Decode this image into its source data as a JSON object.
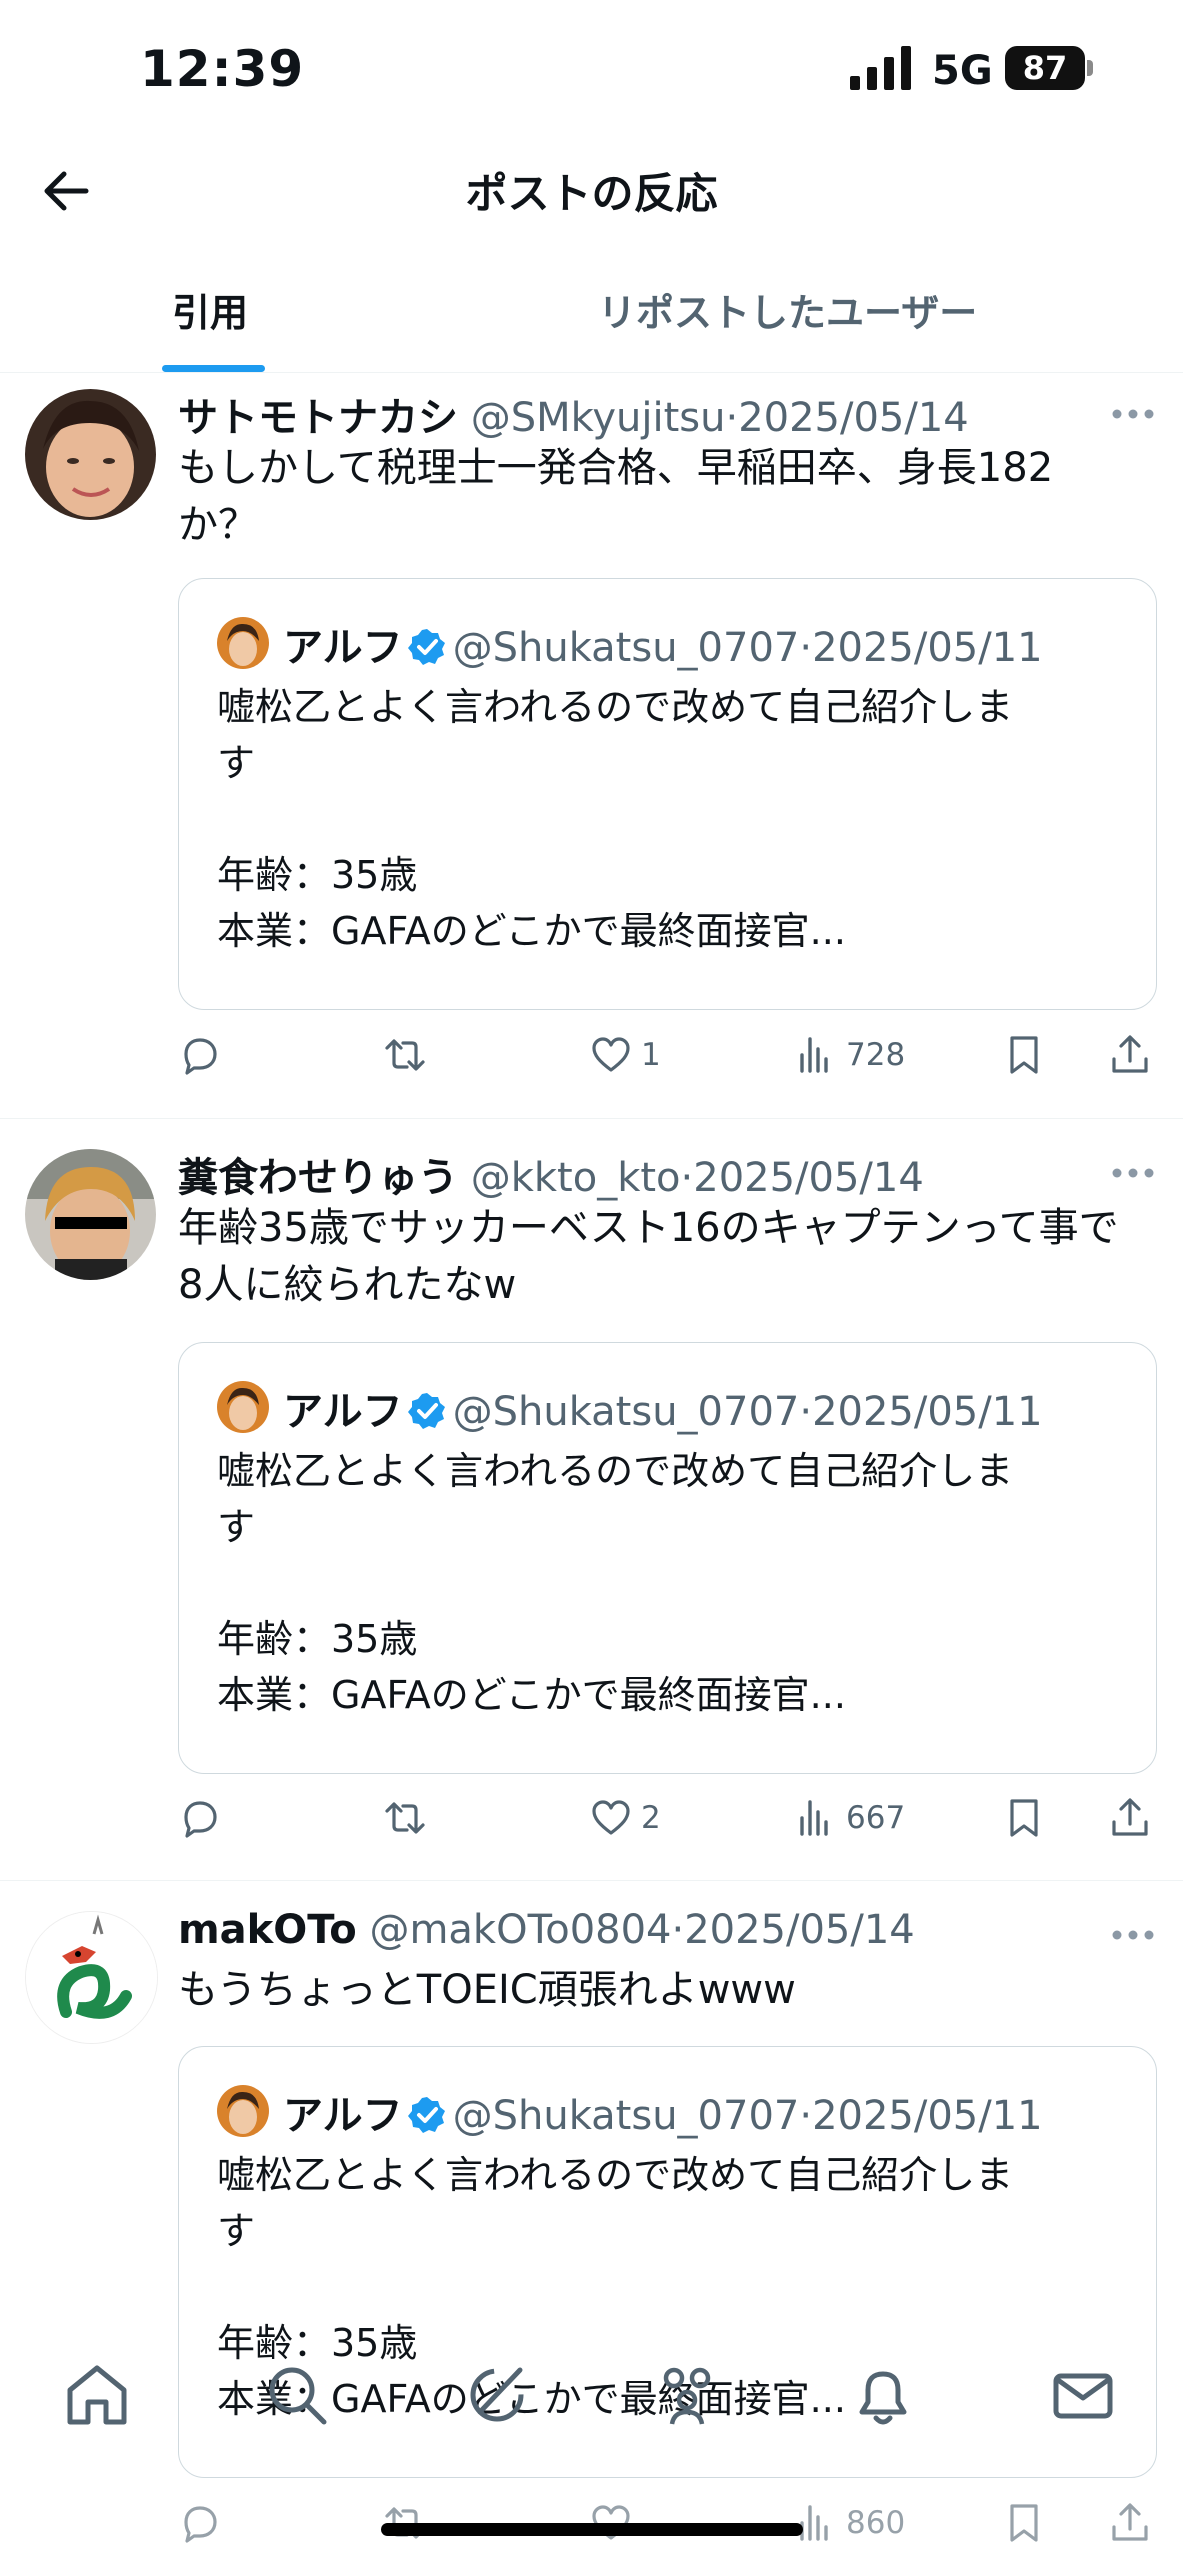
{
  "status_bar": {
    "time": "12:39",
    "network": "5G",
    "battery": "87"
  },
  "header": {
    "title": "ポストの反応"
  },
  "tabs": [
    {
      "label": "引用",
      "active": true
    },
    {
      "label": "リポストしたユーザー",
      "active": false
    }
  ],
  "posts": [
    {
      "name": "サトモトナカシ",
      "handle": "@SMkyujitsu",
      "sep": "·",
      "date": "2025/05/14",
      "text": "もしかして税理士一発合格、早稲田卒、身長182\nか？",
      "quote": {
        "name": "アルフ",
        "handle": "@Shukatsu_0707",
        "sep": "·",
        "date": "2025/05/11",
        "text": "嘘松乙とよく言われるので改めて自己紹介しま\nす\n\n年齢：35歳\n本業：GAFAのどこかで最終面接官..."
      },
      "likes": "1",
      "views": "728"
    },
    {
      "name": "糞食わせりゅう",
      "handle": "@kkto_kto",
      "sep": "·",
      "date": "2025/05/14",
      "text": "年齢35歳でサッカーベスト16のキャプテンって事で\n8人に絞られたなw",
      "quote": {
        "name": "アルフ",
        "handle": "@Shukatsu_0707",
        "sep": "·",
        "date": "2025/05/11",
        "text": "嘘松乙とよく言われるので改めて自己紹介しま\nす\n\n年齢：35歳\n本業：GAFAのどこかで最終面接官..."
      },
      "likes": "2",
      "views": "667"
    },
    {
      "name": "makOTo",
      "handle": "@makOTo0804",
      "sep": "·",
      "date": "2025/05/14",
      "text": "もうちょっとTOEIC頑張れよwww",
      "quote": {
        "name": "アルフ",
        "handle": "@Shukatsu_0707",
        "sep": "·",
        "date": "2025/05/11",
        "text": "嘘松乙とよく言われるので改めて自己紹介しま\nす\n\n年齢：35歳\n本業：GAFAのどこかで最終面接官..."
      },
      "likes": "",
      "views": "860"
    }
  ],
  "icons": {
    "back": "arrow-left-icon",
    "more": "more-dots-icon",
    "reply": "reply-icon",
    "repost": "repost-icon",
    "like": "heart-icon",
    "views": "views-icon",
    "bookmark": "bookmark-icon",
    "share": "share-icon",
    "verified": "verified-badge-icon"
  },
  "nav": [
    "home-icon",
    "search-icon",
    "grok-icon",
    "communities-icon",
    "notifications-icon",
    "messages-icon"
  ],
  "colors": {
    "accent": "#1d9bf0",
    "text": "#0f1419",
    "muted": "#536471",
    "border": "#cfd9de"
  }
}
